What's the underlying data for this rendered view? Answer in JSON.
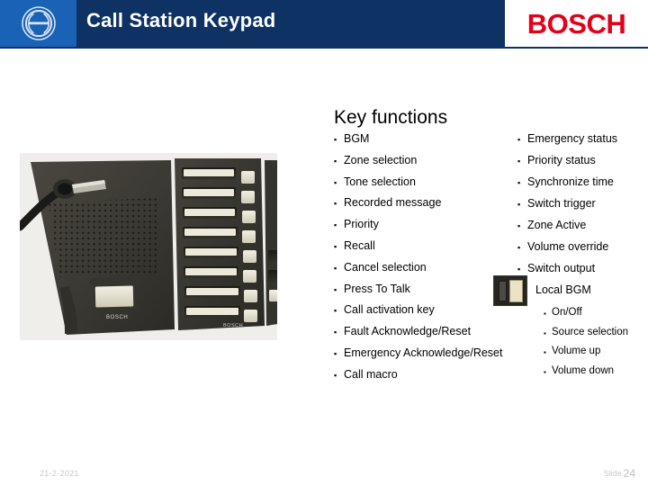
{
  "header": {
    "logo_icon": "bosch-symbol-icon",
    "title": "Call Station Keypad",
    "brand": "BOSCH",
    "brand_color": "#e2001a",
    "bar_color": "#0d3263",
    "logo_box_color": "#1a62b5"
  },
  "photo": {
    "alt": "Bosch call station with keypad extension panel",
    "device_label": "BOSCH"
  },
  "content": {
    "title": "Key functions",
    "left_column": [
      "BGM",
      "Zone selection",
      "Tone selection",
      "Recorded message",
      "Priority",
      "Recall",
      "Cancel selection",
      "Press To Talk",
      "Call activation key",
      "Fault Acknowledge/Reset",
      "Emergency Acknowledge/Reset",
      "Call macro"
    ],
    "right_column": [
      "Emergency status",
      "Priority status",
      "Synchronize time",
      "Switch trigger",
      "Zone Active",
      "Volume override",
      "Switch output"
    ],
    "local_bgm": {
      "thumb_icon": "keypad-key-thumbnail-icon",
      "label": "Local BGM",
      "items": [
        "On/Off",
        "Source selection",
        "Volume up",
        "Volume down"
      ]
    },
    "bullet_glyph": "▪"
  },
  "footer": {
    "date": "21-2-2021",
    "slide_label": "Slide",
    "slide_number": "24"
  }
}
